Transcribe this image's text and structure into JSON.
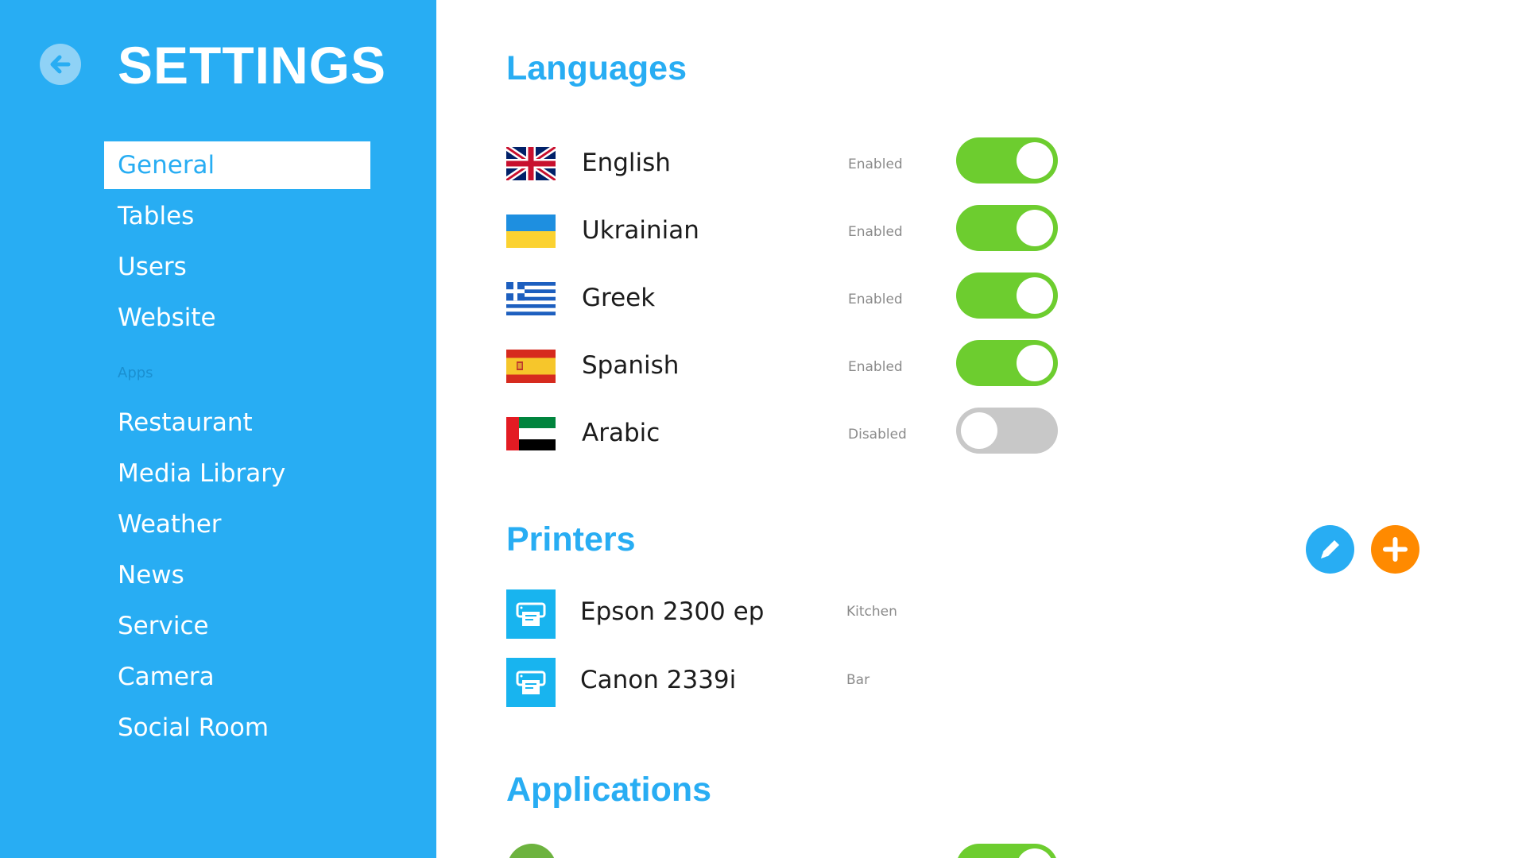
{
  "colors": {
    "sidebar_bg": "#28adf3",
    "accent": "#28adf3",
    "toggle_on": "#6dcd2f",
    "toggle_off": "#c8c8c8",
    "add_button": "#ff8a00"
  },
  "sidebar": {
    "back_icon": "arrow-left-icon",
    "title": "SETTINGS",
    "items": [
      {
        "label": "General",
        "active": true
      },
      {
        "label": "Tables"
      },
      {
        "label": "Users"
      },
      {
        "label": "Website"
      }
    ],
    "apps_section_label": "Apps",
    "app_items": [
      {
        "label": "Restaurant"
      },
      {
        "label": "Media Library"
      },
      {
        "label": "Weather"
      },
      {
        "label": "News"
      },
      {
        "label": "Service"
      },
      {
        "label": "Camera"
      },
      {
        "label": "Social Room"
      }
    ]
  },
  "languages": {
    "title": "Languages",
    "items": [
      {
        "name": "English",
        "status": "Enabled",
        "enabled": true,
        "flag": "uk-flag-icon"
      },
      {
        "name": "Ukrainian",
        "status": "Enabled",
        "enabled": true,
        "flag": "ukraine-flag-icon"
      },
      {
        "name": "Greek",
        "status": "Enabled",
        "enabled": true,
        "flag": "greece-flag-icon"
      },
      {
        "name": "Spanish",
        "status": "Enabled",
        "enabled": true,
        "flag": "spain-flag-icon"
      },
      {
        "name": "Arabic",
        "status": "Disabled",
        "enabled": false,
        "flag": "uae-flag-icon"
      }
    ]
  },
  "printers": {
    "title": "Printers",
    "edit_icon": "pencil-icon",
    "add_icon": "plus-icon",
    "items": [
      {
        "name": "Epson 2300 ep",
        "location": "Kitchen",
        "icon": "printer-icon"
      },
      {
        "name": "Canon 2339i",
        "location": "Bar",
        "icon": "printer-icon"
      }
    ]
  },
  "applications": {
    "title": "Applications"
  }
}
